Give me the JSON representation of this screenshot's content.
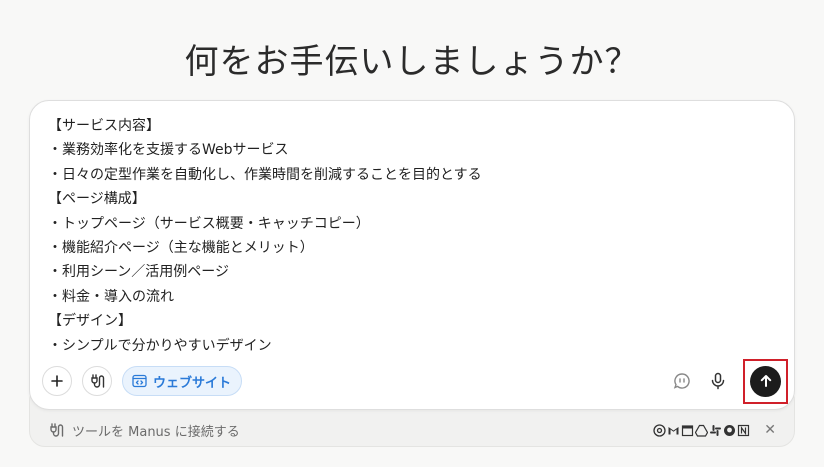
{
  "headline": "何をお手伝いしましょうか？",
  "composer": {
    "lines": [
      "【サービス内容】",
      "・業務効率化を支援するWebサービス",
      "・日々の定型作業を自動化し、作業時間を削減することを目的とする",
      "【ページ構成】",
      "・トップページ（サービス概要・キャッチコピー）",
      "・機能紹介ページ（主な機能とメリット）",
      "・利用シーン／活用例ページ",
      "・料金・導入の流れ",
      "【デザイン】",
      "・シンプルで分かりやすいデザイン"
    ],
    "chip_label": "ウェブサイト",
    "icons": {
      "add": "plus-icon",
      "tools": "plug-icon",
      "chip": "code-window-icon",
      "speech": "speech-bubble-icon",
      "mic": "microphone-icon",
      "send": "arrow-up-icon"
    },
    "accent_color": "#2a7ad8",
    "highlight_color": "#d0202a"
  },
  "connect_bar": {
    "label": "ツールを Manus に接続する",
    "tools": [
      "chrome-icon",
      "gmail-icon",
      "calendar-icon",
      "drive-icon",
      "slack-icon",
      "github-icon",
      "notion-icon"
    ]
  }
}
